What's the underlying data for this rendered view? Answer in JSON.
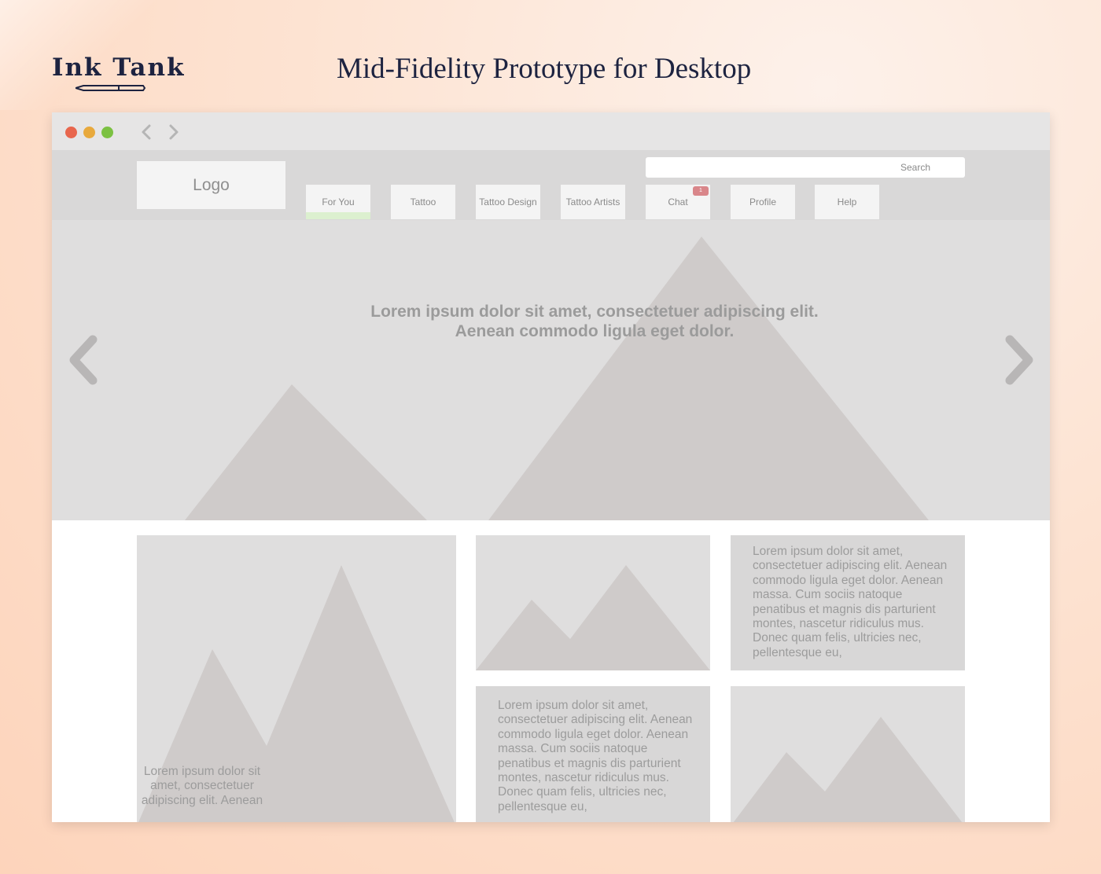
{
  "brand": {
    "name": "Ink Tank"
  },
  "page_title": "Mid-Fidelity Prototype for Desktop",
  "site": {
    "logo": "Logo",
    "search_placeholder": "Search",
    "nav": [
      {
        "label": "For You"
      },
      {
        "label": "Tattoo"
      },
      {
        "label": "Tattoo Design"
      },
      {
        "label": "Tattoo Artists"
      },
      {
        "label": "Chat",
        "badge": "1"
      },
      {
        "label": "Profile"
      },
      {
        "label": "Help"
      }
    ],
    "hero": {
      "line1": "Lorem ipsum dolor sit amet, consectetuer adipiscing elit.",
      "line2": "Aenean commodo ligula eget dolor."
    },
    "cards": {
      "large_caption": "Lorem ipsum dolor sit amet, consectetuer adipiscing elit. Aenean",
      "text_top": "Lorem ipsum dolor sit amet, consectetuer adipiscing elit. Aenean commodo ligula eget dolor. Aenean massa. Cum sociis natoque penatibus et magnis dis parturient montes, nascetur ridiculus mus. Donec quam felis, ultricies nec, pellentesque eu,",
      "text_bottom": "Lorem ipsum dolor sit amet, consectetuer adipiscing elit. Aenean commodo ligula eget dolor. Aenean massa. Cum sociis natoque penatibus et magnis dis parturient montes, nascetur ridiculus mus. Donec quam felis, ultricies nec, pellentesque eu,"
    }
  },
  "colors": {
    "accent_active_tab": "#dcf0cf",
    "chat_badge": "#d9868a",
    "window_close": "#e8664d",
    "window_minimize": "#e8a93c",
    "window_zoom": "#7cc142"
  }
}
